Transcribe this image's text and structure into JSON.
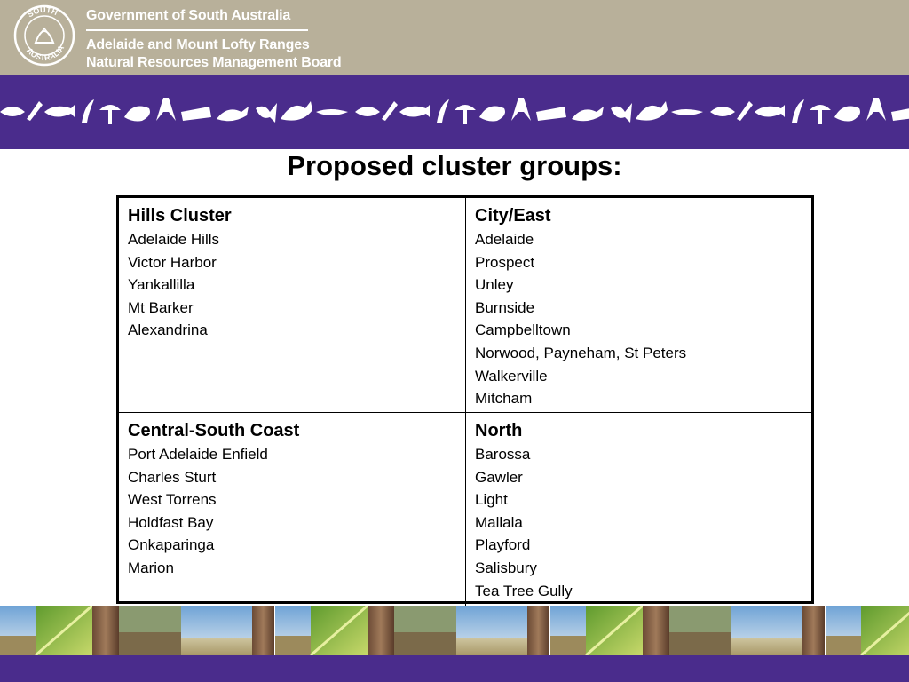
{
  "header": {
    "org_line1": "Government of South Australia",
    "org_line2": "Adelaide and Mount Lofty Ranges",
    "org_line3": "Natural Resources Management Board",
    "seal_text": "SOUTH AUSTRALIA"
  },
  "title": "Proposed cluster groups:",
  "clusters": [
    {
      "heading": "Hills Cluster",
      "items": [
        "Adelaide Hills",
        "Victor Harbor",
        "Yankallilla",
        "Mt Barker",
        "Alexandrina"
      ]
    },
    {
      "heading": "City/East",
      "items": [
        "Adelaide",
        "Prospect",
        "Unley",
        "Burnside",
        "Campbelltown",
        "Norwood, Payneham, St Peters",
        "Walkerville",
        "Mitcham"
      ]
    },
    {
      "heading": "Central-South Coast",
      "items": [
        "Port Adelaide Enfield",
        "Charles Sturt",
        "West Torrens",
        "Holdfast Bay",
        "Onkaparinga",
        "Marion"
      ]
    },
    {
      "heading": "North",
      "items": [
        "Barossa",
        "Gawler",
        "Light",
        "Mallala",
        "Playford",
        "Salisbury",
        "Tea Tree Gully"
      ]
    }
  ],
  "colors": {
    "header_beige": "#b8b09a",
    "purple": "#4a2c8c",
    "motif_white": "#ffffff"
  }
}
